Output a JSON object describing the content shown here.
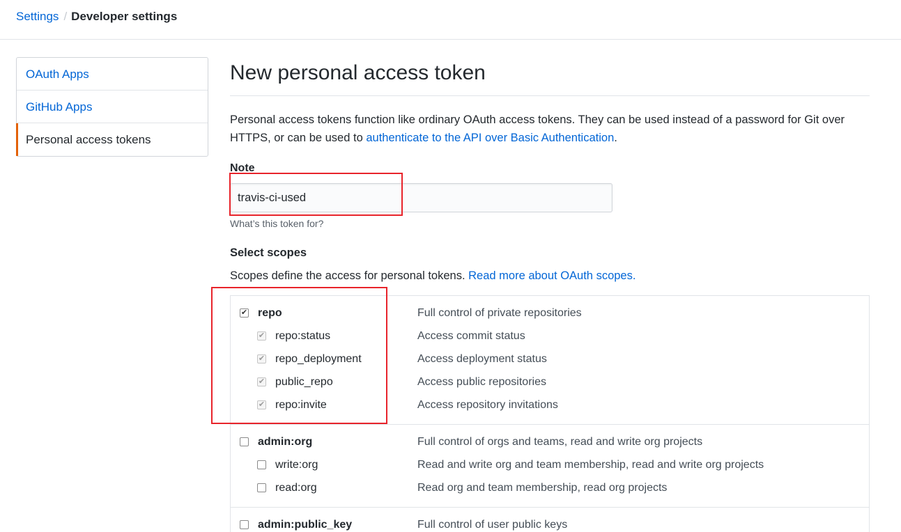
{
  "breadcrumb": {
    "parent": "Settings",
    "separator": "/",
    "current": "Developer settings"
  },
  "sidebar": {
    "items": [
      {
        "label": "OAuth Apps"
      },
      {
        "label": "GitHub Apps"
      },
      {
        "label": "Personal access tokens"
      }
    ]
  },
  "main": {
    "title": "New personal access token",
    "intro_text": "Personal access tokens function like ordinary OAuth access tokens. They can be used instead of a password for Git over HTTPS, or can be used to ",
    "intro_link": "authenticate to the API over Basic Authentication",
    "intro_end": ".",
    "note": {
      "label": "Note",
      "value": "travis-ci-used",
      "hint": "What’s this token for?"
    },
    "scopes": {
      "title": "Select scopes",
      "desc_text": "Scopes define the access for personal tokens. ",
      "desc_link": "Read more about OAuth scopes.",
      "groups": [
        {
          "name": "repo",
          "desc": "Full control of private repositories",
          "checked": true,
          "children": [
            {
              "name": "repo:status",
              "desc": "Access commit status",
              "checked": true
            },
            {
              "name": "repo_deployment",
              "desc": "Access deployment status",
              "checked": true
            },
            {
              "name": "public_repo",
              "desc": "Access public repositories",
              "checked": true
            },
            {
              "name": "repo:invite",
              "desc": "Access repository invitations",
              "checked": true
            }
          ]
        },
        {
          "name": "admin:org",
          "desc": "Full control of orgs and teams, read and write org projects",
          "checked": false,
          "children": [
            {
              "name": "write:org",
              "desc": "Read and write org and team membership, read and write org projects",
              "checked": false
            },
            {
              "name": "read:org",
              "desc": "Read org and team membership, read org projects",
              "checked": false
            }
          ]
        },
        {
          "name": "admin:public_key",
          "desc": "Full control of user public keys",
          "checked": false,
          "children": []
        }
      ]
    }
  },
  "icons": {
    "check": "✔"
  },
  "colors": {
    "link": "#0366d6",
    "accent": "#e36209",
    "highlight": "#e8242b"
  }
}
